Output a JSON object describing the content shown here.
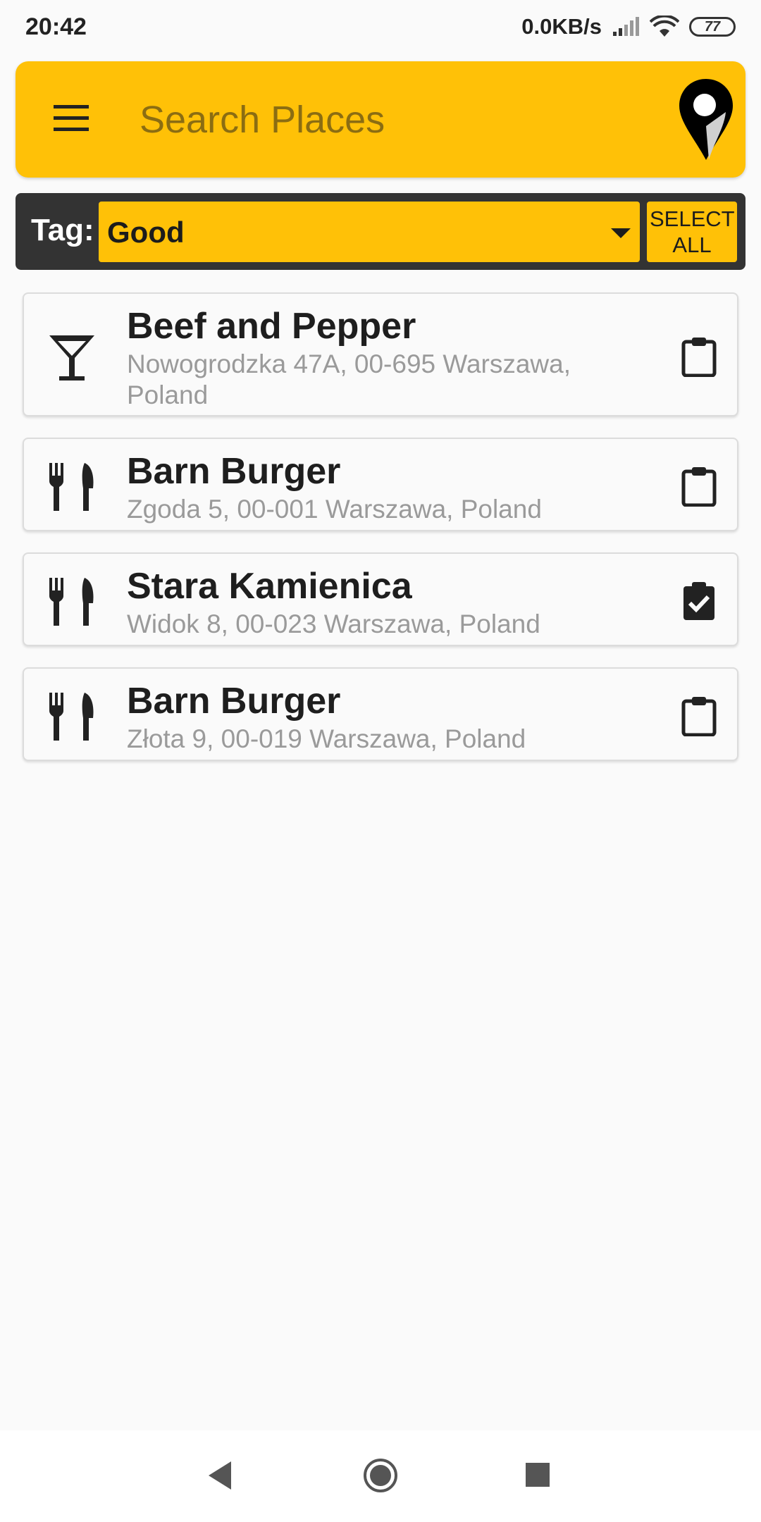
{
  "status_bar": {
    "time": "20:42",
    "network_speed": "0.0KB/s",
    "battery": "77"
  },
  "search": {
    "placeholder": "Search Places"
  },
  "tag_filter": {
    "label": "Tag:",
    "selected": "Good",
    "select_all_label": "SELECT ALL"
  },
  "places": [
    {
      "name": "Beef and Pepper",
      "address": "Nowogrodzka 47A, 00-695 Warszawa, Poland",
      "icon": "cocktail-icon",
      "checked": false
    },
    {
      "name": "Barn Burger",
      "address": "Zgoda 5, 00-001 Warszawa, Poland",
      "icon": "restaurant-icon",
      "checked": false
    },
    {
      "name": "Stara Kamienica",
      "address": "Widok 8, 00-023 Warszawa, Poland",
      "icon": "restaurant-icon",
      "checked": true
    },
    {
      "name": "Barn Burger",
      "address": "Złota 9, 00-019 Warszawa, Poland",
      "icon": "restaurant-icon",
      "checked": false
    }
  ],
  "colors": {
    "accent": "#ffc107",
    "tag_bar_bg": "#333333",
    "background": "#fafafa"
  }
}
